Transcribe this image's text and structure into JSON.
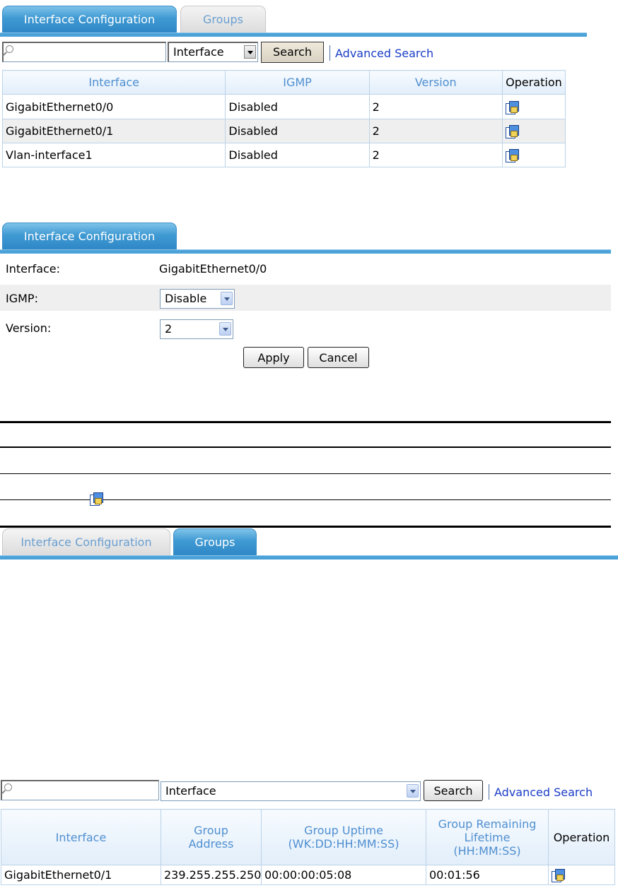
{
  "panel1": {
    "tabs": [
      {
        "label": "Interface Configuration",
        "active": true
      },
      {
        "label": "Groups",
        "active": false
      }
    ],
    "search": {
      "value": "",
      "filter_selected": "Interface",
      "button_label": "Search",
      "advanced_label": "Advanced Search"
    },
    "table": {
      "headers": [
        "Interface",
        "IGMP",
        "Version",
        "Operation"
      ],
      "rows": [
        {
          "interface": "GigabitEthernet0/0",
          "igmp": "Disabled",
          "version": "2"
        },
        {
          "interface": "GigabitEthernet0/1",
          "igmp": "Disabled",
          "version": "2"
        },
        {
          "interface": "Vlan-interface1",
          "igmp": "Disabled",
          "version": "2"
        }
      ]
    }
  },
  "panel2": {
    "tab_label": "Interface Configuration",
    "interface_label": "Interface:",
    "interface_value": "GigabitEthernet0/0",
    "igmp_label": "IGMP:",
    "igmp_value": "Disable",
    "version_label": "Version:",
    "version_value": "2",
    "apply_label": "Apply",
    "cancel_label": "Cancel"
  },
  "panel3": {
    "tabs": [
      {
        "label": "Interface Configuration",
        "active": false
      },
      {
        "label": "Groups",
        "active": true
      }
    ],
    "search": {
      "value": "",
      "filter_selected": "Interface",
      "button_label": "Search",
      "advanced_label": "Advanced Search"
    },
    "table": {
      "headers": [
        "Interface",
        "Group\nAddress",
        "Group Uptime\n(WK:DD:HH:MM:SS)",
        "Group Remaining\nLifetime\n(HH:MM:SS)",
        "Operation"
      ],
      "rows": [
        {
          "interface": "GigabitEthernet0/1",
          "group_address": "239.255.255.250",
          "uptime": "00:00:00:05:08",
          "remaining": "00:01:56"
        }
      ]
    }
  },
  "icons": {
    "operation": "modify-icon"
  },
  "colors": {
    "tab_active": "#3f9ad3",
    "tab_inactive_text": "#6a9fd0",
    "header_text": "#4f8fd0",
    "link": "#1a3dc7",
    "alt_row": "#efefef"
  }
}
